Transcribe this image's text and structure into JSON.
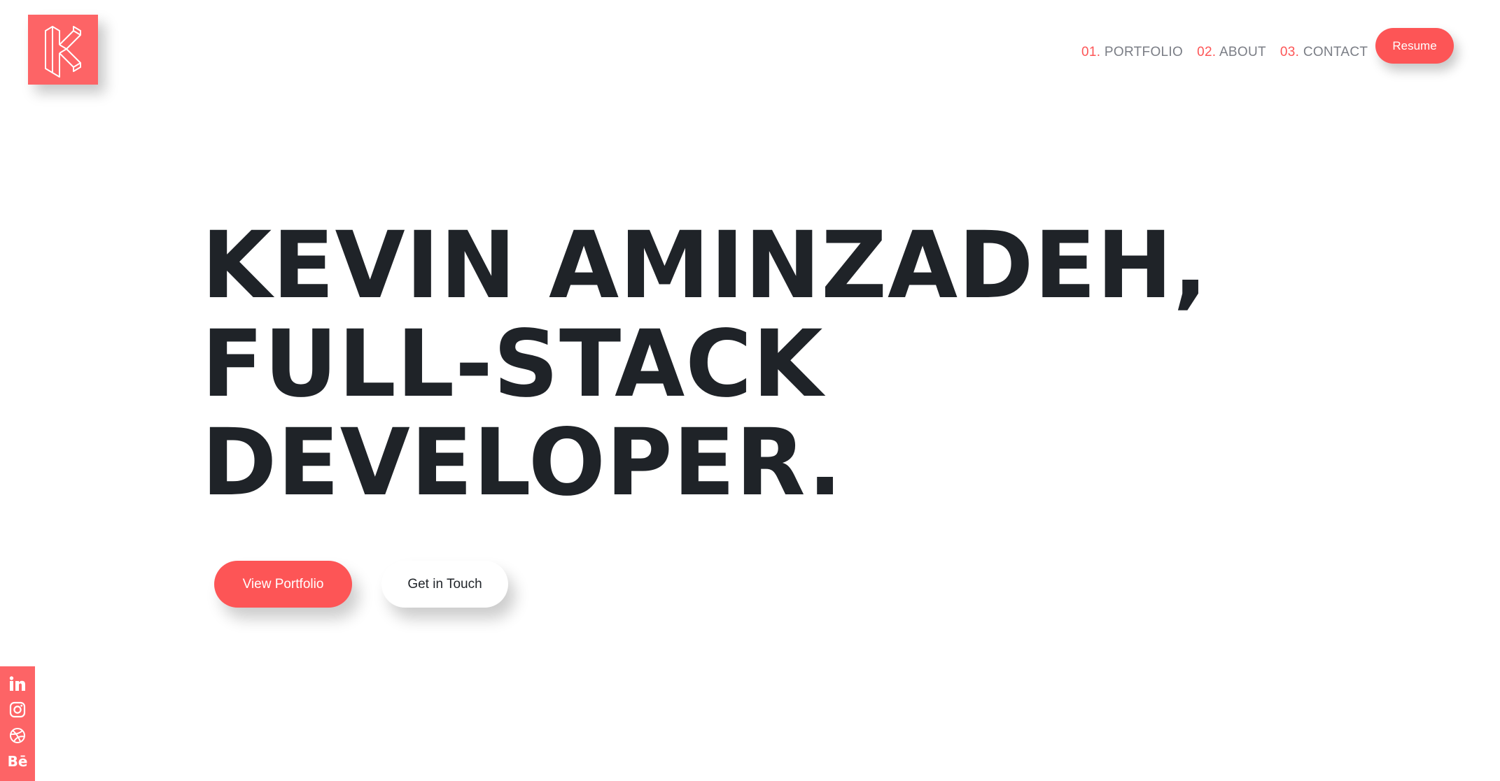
{
  "header": {
    "logo_icon": "k-monogram-logo-icon",
    "nav": [
      {
        "number": "01.",
        "label": "PORTFOLIO"
      },
      {
        "number": "02.",
        "label": "ABOUT"
      },
      {
        "number": "03.",
        "label": "CONTACT"
      }
    ],
    "resume_label": "Resume"
  },
  "hero": {
    "lines": [
      "KEVIN AMINZADEH,",
      "FULL-STACK",
      "DEVELOPER."
    ],
    "primary_button": "View Portfolio",
    "secondary_button": "Get in Touch"
  },
  "social": {
    "icons": [
      "linkedin-icon",
      "instagram-icon",
      "dribbble-icon",
      "behance-icon"
    ],
    "behance_text": "Bē"
  },
  "colors": {
    "accent": "#fd5556",
    "logo_bg": "#fd6466",
    "heading": "#1f2328",
    "nav_text": "#7a7d85"
  }
}
